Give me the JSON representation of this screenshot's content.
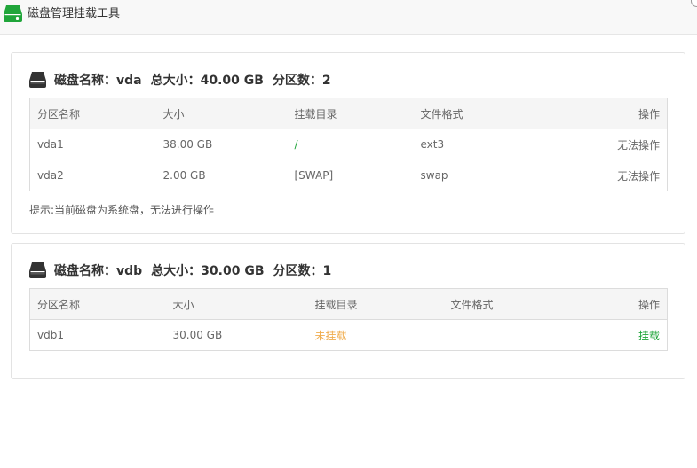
{
  "window": {
    "title": "磁盘管理挂载工具"
  },
  "disks": [
    {
      "name": "磁盘名称：vda",
      "total": "总大小：40.00 GB",
      "partitions_count": "分区数：2",
      "headers": [
        "分区名称",
        "大小",
        "挂载目录",
        "文件格式",
        "操作"
      ],
      "rows": [
        {
          "name": "vda1",
          "size": "38.00 GB",
          "mount": "/",
          "fs": "ext3",
          "action": "无法操作"
        },
        {
          "name": "vda2",
          "size": "2.00 GB",
          "mount": "[SWAP]",
          "fs": "swap",
          "action": "无法操作"
        }
      ],
      "hint": "提示:当前磁盘为系统盘，无法进行操作"
    },
    {
      "name": "磁盘名称：vdb",
      "total": "总大小：30.00 GB",
      "partitions_count": "分区数：1",
      "headers": [
        "分区名称",
        "大小",
        "挂载目录",
        "文件格式",
        "操作"
      ],
      "rows": [
        {
          "name": "vdb1",
          "size": "30.00 GB",
          "mount": "未挂载",
          "fs": "",
          "action": "挂载"
        }
      ]
    }
  ],
  "colors": {
    "accent_green": "#20a53a",
    "warn_orange": "#f0ad4e"
  },
  "icons": {
    "app": "hard-drive-icon",
    "disk": "disk-drive-icon"
  }
}
